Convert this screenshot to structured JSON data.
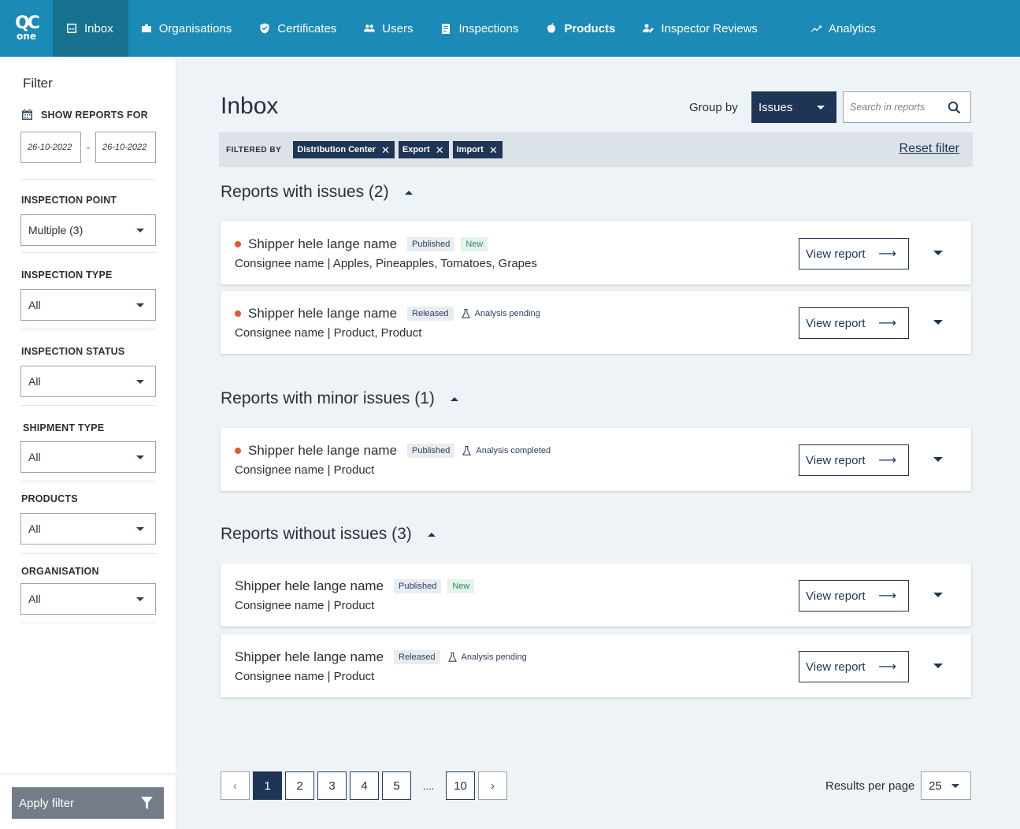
{
  "app": {
    "logo_top": "QC",
    "logo_bottom": "one"
  },
  "nav": {
    "inbox": "Inbox",
    "organisations": "Organisations",
    "certificates": "Certificates",
    "users": "Users",
    "inspections": "Inspections",
    "products": "Products",
    "inspector_reviews": "Inspector Reviews",
    "analytics": "Analytics"
  },
  "sidebar": {
    "title": "Filter",
    "show_reports_for": "SHOW REPORTS FOR",
    "date_from": "26-10-2022",
    "date_separator": "-",
    "date_to": "26-10-2022",
    "inspection_point_label": "INSPECTION POINT",
    "inspection_point_value": "Multiple (3)",
    "inspection_type_label": "INSPECTION TYPE",
    "inspection_type_value": "All",
    "inspection_status_label": "INSPECTION STATUS",
    "inspection_status_value": "All",
    "shipment_type_label": "SHIPMENT TYPE",
    "shipment_type_value": "All",
    "products_label": "PRODUCTS",
    "products_value": "All",
    "organisation_label": "ORGANISATION",
    "organisation_value": "All",
    "apply_label": "Apply filter"
  },
  "main": {
    "title": "Inbox",
    "group_by_label": "Group by",
    "group_by_value": "Issues",
    "search_placeholder": "Search in reports",
    "filtered_by": "FILTERED BY",
    "chips": [
      "Distribution Center",
      "Export",
      "Import"
    ],
    "chip_remove": "✕",
    "reset_filter": "Reset filter"
  },
  "groups": [
    {
      "title": "Reports with issues (2)",
      "reports": [
        {
          "shipper": "Shipper hele lange name",
          "status": "Published",
          "tag": "New",
          "analysis": "",
          "consignee": "Consignee name | Apples, Pineapples, Tomatoes, Grapes",
          "issue": true
        },
        {
          "shipper": "Shipper hele lange name",
          "status": "Released",
          "tag": "",
          "analysis": "Analysis pending",
          "consignee": "Consignee name | Product, Product",
          "issue": true
        }
      ]
    },
    {
      "title": "Reports with minor issues (1)",
      "reports": [
        {
          "shipper": "Shipper hele lange name",
          "status": "Published",
          "tag": "",
          "analysis": "Analysis completed",
          "consignee": "Consignee name | Product",
          "issue": true
        }
      ]
    },
    {
      "title": "Reports without issues (3)",
      "reports": [
        {
          "shipper": "Shipper hele lange name",
          "status": "Published",
          "tag": "New",
          "analysis": "",
          "consignee": "Consignee name | Product",
          "issue": false
        },
        {
          "shipper": "Shipper hele lange name",
          "status": "Released",
          "tag": "",
          "analysis": "Analysis pending",
          "consignee": "Consignee name | Product",
          "issue": false
        }
      ]
    }
  ],
  "report_button": {
    "label": "View report",
    "arrow": "⟶"
  },
  "pagination": {
    "prev": "‹",
    "pages": [
      "1",
      "2",
      "3",
      "4",
      "5"
    ],
    "ellipsis": "....",
    "last": "10",
    "next": "›",
    "current": "1",
    "results_label": "Results per page",
    "results_value": "25"
  },
  "colors": {
    "nav": "#1b8ab7",
    "nav_active": "#16728f",
    "primary": "#1f3556",
    "issue_dot": "#e05a2b",
    "new_badge": "#2e8a5f"
  }
}
